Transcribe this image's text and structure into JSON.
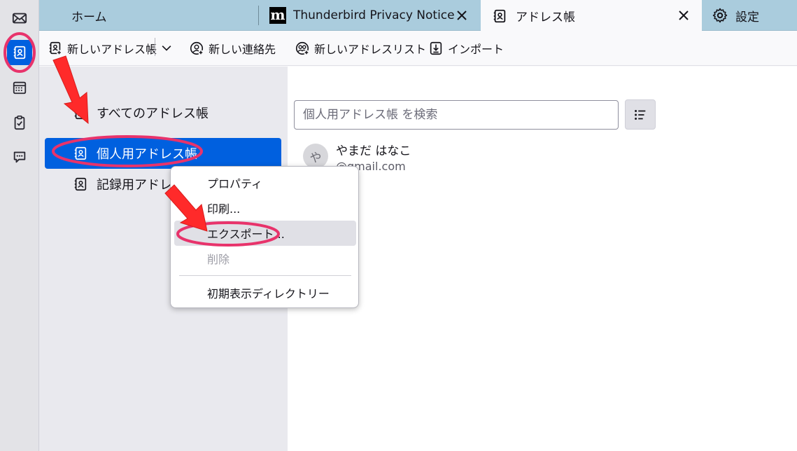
{
  "tabs": [
    {
      "label": "ホーム"
    },
    {
      "label": "Thunderbird Privacy Notice – Mozilla"
    },
    {
      "label": "アドレス帳"
    },
    {
      "label": "設定"
    }
  ],
  "favicon_m": "m",
  "toolbar": {
    "new_addressbook": "新しいアドレス帳",
    "new_contact": "新しい連絡先",
    "new_list": "新しいアドレスリスト",
    "import": "インポート"
  },
  "books": [
    {
      "label": "すべてのアドレス帳"
    },
    {
      "label": "個人用アドレス帳"
    },
    {
      "label": "記録用アドレス帳"
    }
  ],
  "search": {
    "placeholder": "個人用アドレス帳 を検索"
  },
  "contact": {
    "avatar": "や",
    "name": "やまだ はなこ",
    "email": "@gmail.com"
  },
  "context_menu": {
    "properties": "プロパティ",
    "print": "印刷...",
    "export": "エクスポート...",
    "delete": "削除",
    "default_dir": "初期表示ディレクトリー"
  },
  "colors": {
    "accent": "#0060df",
    "tabbar": "#aaccdd",
    "annotation": "#e8336b",
    "arrow": "#ff2a2a"
  }
}
